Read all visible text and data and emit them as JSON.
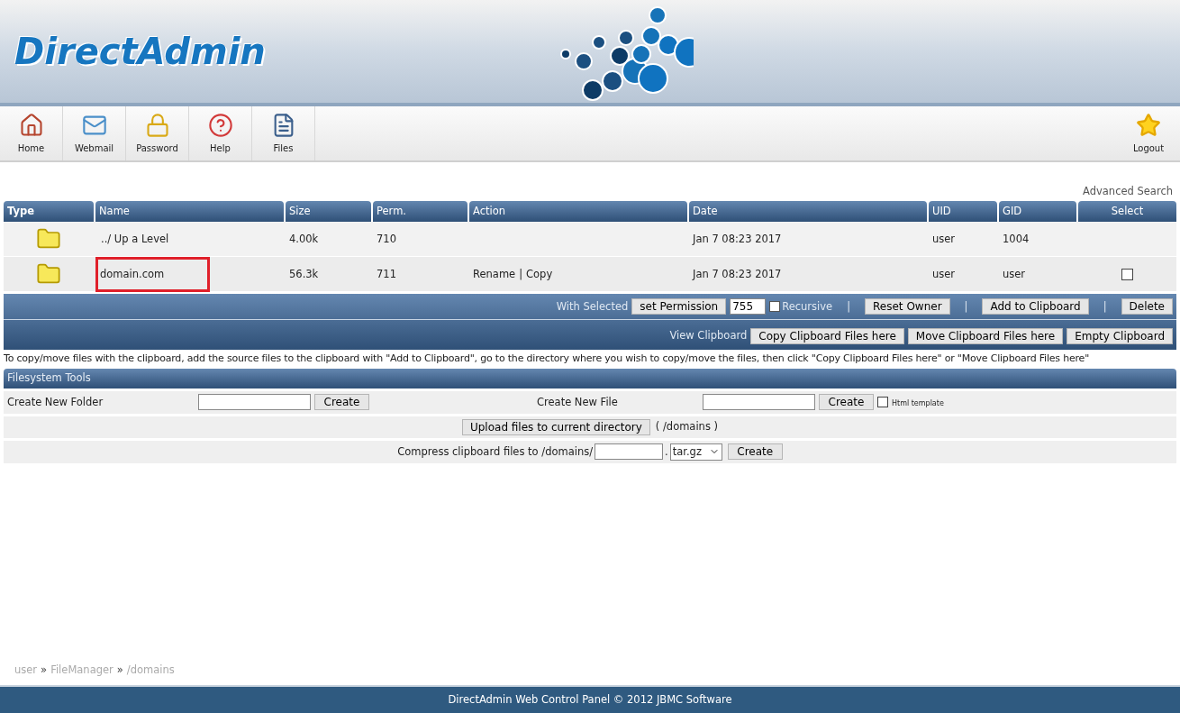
{
  "logo": {
    "text": "DirectAdmin"
  },
  "toolbar": [
    {
      "kind": "home",
      "label": "Home"
    },
    {
      "kind": "webmail",
      "label": "Webmail"
    },
    {
      "kind": "password",
      "label": "Password"
    },
    {
      "kind": "help",
      "label": "Help"
    },
    {
      "kind": "files",
      "label": "Files"
    }
  ],
  "logout": {
    "label": "Logout"
  },
  "advanced_search": "Advanced Search",
  "table": {
    "columns": [
      "Type",
      "Name",
      "Size",
      "Perm.",
      "Action",
      "Date",
      "UID",
      "GID",
      "Select"
    ],
    "action_separator": "|",
    "rows": [
      {
        "name": "../ Up a Level",
        "highlighted": false,
        "size": "4.00k",
        "perm": "710",
        "actions": [],
        "date": "Jan 7 08:23 2017",
        "uid": "user",
        "gid": "1004",
        "selectable": false
      },
      {
        "name": "domain.com",
        "highlighted": true,
        "size": "56.3k",
        "perm": "711",
        "actions": [
          "Rename",
          "Copy"
        ],
        "date": "Jan 7 08:23 2017",
        "uid": "user",
        "gid": "user",
        "selectable": true,
        "checked": false
      }
    ]
  },
  "with_selected": [
    {
      "kind": "label",
      "text": "With Selected"
    },
    {
      "kind": "button",
      "text": "set Permission"
    },
    {
      "kind": "field",
      "text": "755"
    },
    {
      "kind": "checkbox",
      "text": "Recursive",
      "checked": false
    },
    {
      "kind": "separator",
      "text": "|"
    },
    {
      "kind": "button",
      "text": "Reset Owner"
    },
    {
      "kind": "separator",
      "text": "|"
    },
    {
      "kind": "button",
      "text": "Add to Clipboard"
    },
    {
      "kind": "separator",
      "text": "|"
    },
    {
      "kind": "button",
      "text": "Delete"
    }
  ],
  "clipboard": [
    {
      "kind": "label",
      "text": "View Clipboard"
    },
    {
      "kind": "button",
      "text": "Copy Clipboard Files here"
    },
    {
      "kind": "button",
      "text": "Move Clipboard Files here"
    },
    {
      "kind": "button",
      "text": "Empty Clipboard"
    }
  ],
  "clipboard_note": "To copy/move files with the clipboard, add the source files to the clipboard with \"Add to Clipboard\", go to the directory where you wish to copy/move the files, then click \"Copy Clipboard Files here\" or \"Move Clipboard Files here\"",
  "filesystem_tools": {
    "title": "Filesystem Tools",
    "create_folder": {
      "label": "Create New Folder",
      "button": "Create"
    },
    "create_file": {
      "label": "Create New File",
      "button": "Create",
      "template_label": "Html template",
      "template_checked": false
    },
    "upload": {
      "button": "Upload files to current directory",
      "path": "( /domains )"
    },
    "compress": {
      "label": "Compress clipboard files to /domains/",
      "dot": ".",
      "format": "tar.gz",
      "button": "Create"
    }
  },
  "breadcrumb": {
    "separator": "»",
    "items": [
      "user",
      "FileManager",
      "/domains"
    ]
  },
  "footer": "DirectAdmin Web Control Panel © 2012 JBMC Software"
}
